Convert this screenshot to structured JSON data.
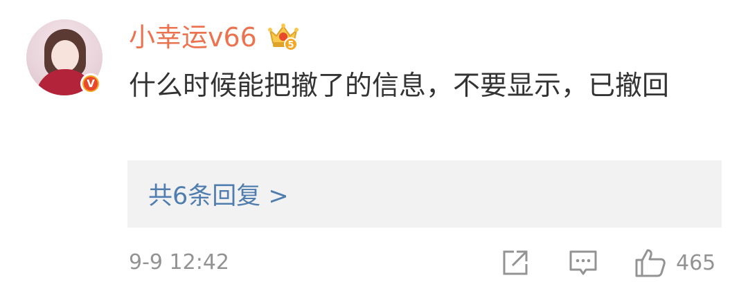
{
  "comment": {
    "username": "小幸运v66",
    "avatar_icon": "user-avatar",
    "verified_badge": {
      "letter": "V",
      "color": "#f5a623",
      "inner_color": "#e8492c"
    },
    "crown_icon": "crown-level-icon",
    "crown_level": "5",
    "text": "什么时候能把撤了的信息，不要显示，已撤回",
    "replies_link": "共6条回复 >",
    "time": "9-9 12:42",
    "actions": {
      "share_icon": "share-icon",
      "comment_icon": "comment-icon",
      "like_icon": "thumbs-up-icon",
      "like_count": "465"
    },
    "colors": {
      "username": "#eb7350",
      "text": "#333333",
      "link": "#507daf",
      "meta": "#939393",
      "reply_bg": "#f2f2f2"
    }
  }
}
